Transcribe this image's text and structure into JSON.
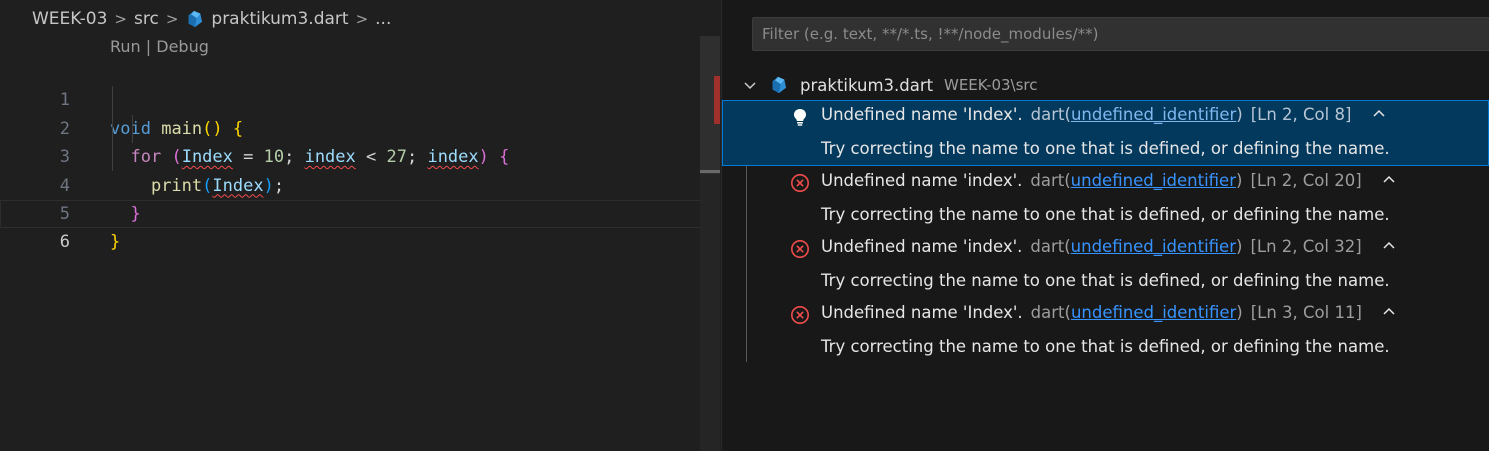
{
  "editor": {
    "breadcrumb": {
      "folder": "WEEK-03",
      "subfolder": "src",
      "file": "praktikum3.dart",
      "more": "..."
    },
    "codelens": "Run | Debug",
    "lines": [
      {
        "number": "1"
      },
      {
        "number": "2"
      },
      {
        "number": "3"
      },
      {
        "number": "4"
      },
      {
        "number": "5"
      },
      {
        "number": "6"
      }
    ],
    "tokens": {
      "void": "void",
      "main": "main",
      "paren_open": "(",
      "paren_close": ")",
      "brace_open": "{",
      "for": "for",
      "Index": "Index",
      "assign": " = ",
      "ten": "10",
      "semi": "; ",
      "index": "index",
      "lt": " < ",
      "twentyseven": "27",
      "print": "print",
      "semicolon": ";",
      "brace_close": "}"
    }
  },
  "problems": {
    "filter_placeholder": "Filter (e.g. text, **/*.ts, !**/node_modules/**)",
    "file": {
      "name": "praktikum3.dart",
      "path": "WEEK-03\\src"
    },
    "items": [
      {
        "message": "Undefined name 'Index'.",
        "source": "dart(",
        "code": "undefined_identifier",
        "source_close": ")",
        "location": "[Ln 2, Col 8]",
        "hint": "Try correcting the name to one that is defined, or defining the name.",
        "icon": "lightbulb-icon"
      },
      {
        "message": "Undefined name 'index'.",
        "source": "dart(",
        "code": "undefined_identifier",
        "source_close": ")",
        "location": "[Ln 2, Col 20]",
        "hint": "Try correcting the name to one that is defined, or defining the name.",
        "icon": "error-icon"
      },
      {
        "message": "Undefined name 'index'.",
        "source": "dart(",
        "code": "undefined_identifier",
        "source_close": ")",
        "location": "[Ln 2, Col 32]",
        "hint": "Try correcting the name to one that is defined, or defining the name.",
        "icon": "error-icon"
      },
      {
        "message": "Undefined name 'Index'.",
        "source": "dart(",
        "code": "undefined_identifier",
        "source_close": ")",
        "location": "[Ln 3, Col 11]",
        "hint": "Try correcting the name to one that is defined, or defining the name.",
        "icon": "error-icon"
      }
    ]
  },
  "colors": {
    "accent": "#0078d4",
    "selection": "#04395e",
    "error": "#f14c4c",
    "link": "#3794ff"
  }
}
